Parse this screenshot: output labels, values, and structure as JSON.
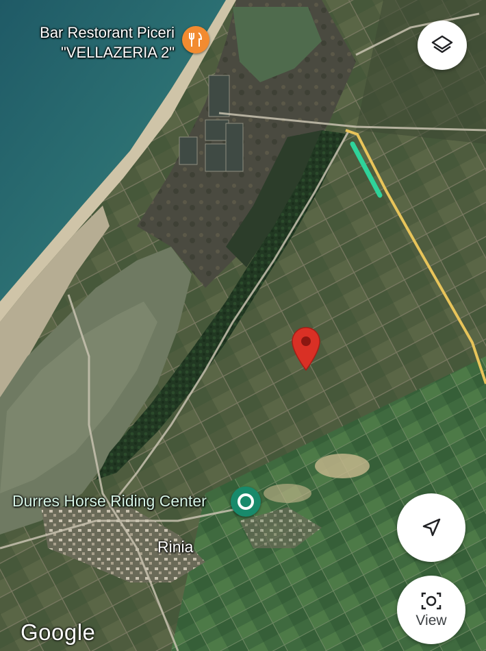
{
  "map": {
    "attribution": "Google",
    "poi": [
      {
        "id": "restaurant",
        "name_line1": "Bar Restorant Piceri",
        "name_line2": "\"VELLAZERIA 2\"",
        "icon": "fork-knife-icon",
        "color": "#f28b30"
      },
      {
        "id": "horse",
        "name": "Durres Horse Riding Center",
        "icon": "park-pin-icon",
        "color": "#188a6b"
      }
    ],
    "locality": "Rinia",
    "selected_pin": {
      "icon": "red-location-pin-icon",
      "color": "#d93025"
    },
    "route_colors": {
      "road": "#e8c45a",
      "highlight": "#2fd39a"
    }
  },
  "controls": {
    "layers_icon": "layers-icon",
    "locate_icon": "navigation-arrow-icon",
    "view_label": "View",
    "view_icon": "camera-view-icon"
  }
}
